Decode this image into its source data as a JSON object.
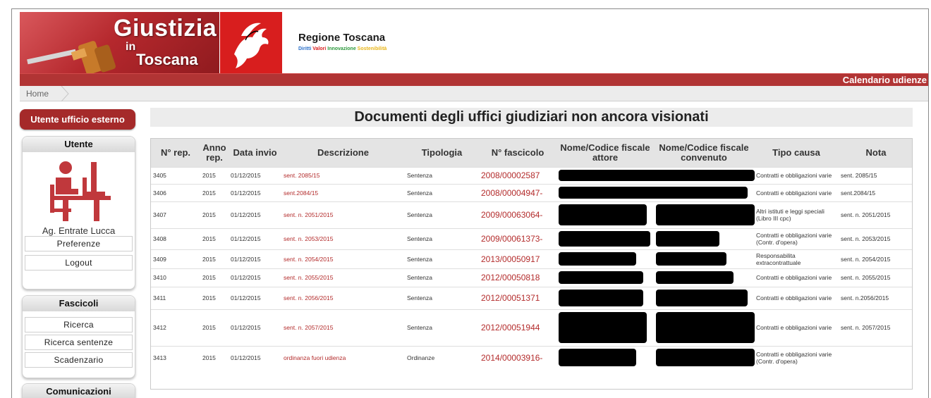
{
  "header": {
    "logo_title": "Giustizia",
    "logo_in": "in",
    "logo_region": "Toscana",
    "region_name": "Regione Toscana",
    "region_motto": [
      {
        "text": "Diritti",
        "color": "#2a6fc9"
      },
      {
        "text": "Valori",
        "color": "#d81e1e"
      },
      {
        "text": "Innovazione",
        "color": "#2e9a3e"
      },
      {
        "text": "Sostenibilità",
        "color": "#e9b61a"
      }
    ],
    "calendar_link": "Calendario udienze"
  },
  "breadcrumb": {
    "home": "Home"
  },
  "sidebar": {
    "user_type_button": "Utente ufficio esterno",
    "user_panel": {
      "title": "Utente",
      "user_name": "Ag. Entrate Lucca",
      "links": [
        "Preferenze",
        "Logout"
      ]
    },
    "fascicoli_panel": {
      "title": "Fascicoli",
      "links": [
        "Ricerca",
        "Ricerca sentenze",
        "Scadenzario"
      ]
    },
    "comunicazioni_panel": {
      "title": "Comunicazioni"
    }
  },
  "main": {
    "title": "Documenti degli uffici giudiziari non ancora visionati",
    "columns": [
      "N° rep.",
      "Anno rep.",
      "Data invio",
      "Descrizione",
      "Tipologia",
      "N° fascicolo",
      "Nome/Codice fiscale attore",
      "Nome/Codice fiscale convenuto",
      "Tipo causa",
      "Nota"
    ],
    "rows": [
      {
        "rep": "3405",
        "anno": "2015",
        "data": "01/12/2015",
        "descrizione": "sent. 2085/15",
        "tipologia": "Sentenza",
        "fascicolo": "2008/00002587",
        "tipo_causa": "Contratti e obbligazioni varie",
        "nota": "sent. 2085/15"
      },
      {
        "rep": "3406",
        "anno": "2015",
        "data": "01/12/2015",
        "descrizione": "sent.2084/15",
        "tipologia": "Sentenza",
        "fascicolo": "2008/00004947-",
        "tipo_causa": "Contratti e obbligazioni varie",
        "nota": "sent.2084/15"
      },
      {
        "rep": "3407",
        "anno": "2015",
        "data": "01/12/2015",
        "descrizione": "sent. n. 2051/2015",
        "tipologia": "Sentenza",
        "fascicolo": "2009/00063064-",
        "tipo_causa": "Altri istituti e leggi speciali (Libro III cpc)",
        "nota": "sent. n. 2051/2015"
      },
      {
        "rep": "3408",
        "anno": "2015",
        "data": "01/12/2015",
        "descrizione": "sent. n. 2053/2015",
        "tipologia": "Sentenza",
        "fascicolo": "2009/00061373-",
        "tipo_causa": "Contratti e obbligazioni varie (Contr. d'opera)",
        "nota": "sent. n. 2053/2015"
      },
      {
        "rep": "3409",
        "anno": "2015",
        "data": "01/12/2015",
        "descrizione": "sent. n. 2054/2015",
        "tipologia": "Sentenza",
        "fascicolo": "2013/00050917",
        "tipo_causa": "Responsabilita extracontrattuale",
        "nota": "sent. n. 2054/2015"
      },
      {
        "rep": "3410",
        "anno": "2015",
        "data": "01/12/2015",
        "descrizione": "sent. n. 2055/2015",
        "tipologia": "Sentenza",
        "fascicolo": "2012/00050818",
        "tipo_causa": "Contratti e obbligazioni varie",
        "nota": "sent. n. 2055/2015"
      },
      {
        "rep": "3411",
        "anno": "2015",
        "data": "01/12/2015",
        "descrizione": "sent. n. 2056/2015",
        "tipologia": "Sentenza",
        "fascicolo": "2012/00051371",
        "tipo_causa": "Contratti e obbligazioni varie",
        "nota": "sent. n.2056/2015"
      },
      {
        "rep": "3412",
        "anno": "2015",
        "data": "01/12/2015",
        "descrizione": "sent. n. 2057/2015",
        "tipologia": "Sentenza",
        "fascicolo": "2012/00051944",
        "tipo_causa": "Contratti e obbligazioni varie",
        "nota": "sent. n. 2057/2015"
      },
      {
        "rep": "3413",
        "anno": "2015",
        "data": "01/12/2015",
        "descrizione": "ordinanza fuori udienza",
        "tipologia": "Ordinanze",
        "fascicolo": "2014/00003916-",
        "tipo_causa": "Contratti e obbligazioni varie (Contr. d'opera)",
        "nota": ""
      }
    ]
  }
}
